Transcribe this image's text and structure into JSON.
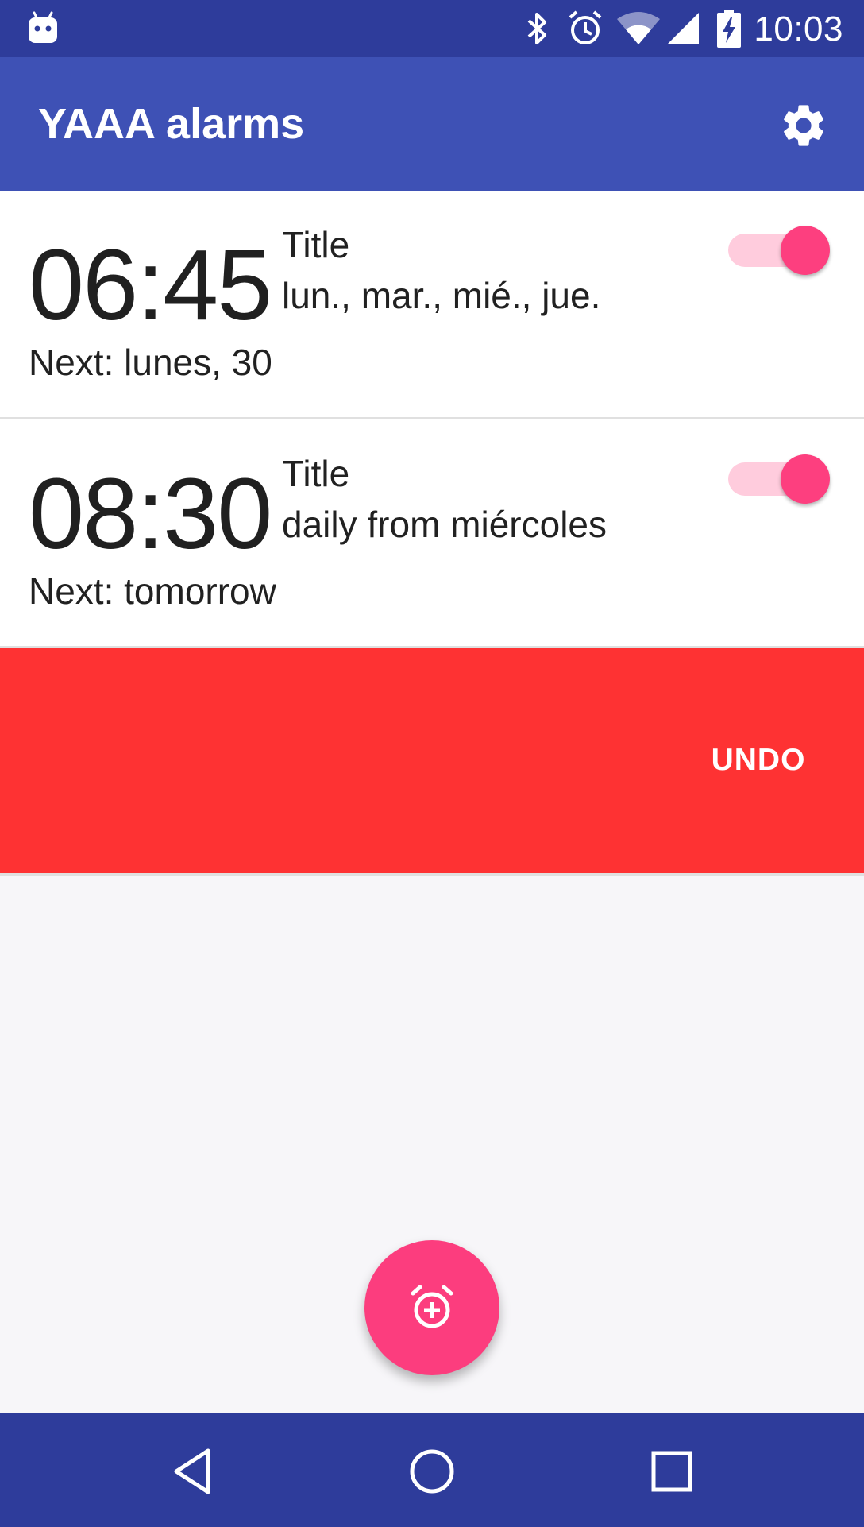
{
  "status_bar": {
    "time": "10:03",
    "icons": [
      "android-notification-icon",
      "bluetooth-icon",
      "alarm-clock-icon",
      "wifi-icon",
      "cell-signal-icon",
      "battery-charging-icon"
    ]
  },
  "app_bar": {
    "title": "YAAA alarms",
    "settings_icon": "gear-icon"
  },
  "alarms": [
    {
      "time": "06:45",
      "title": "Title",
      "days": "lun., mar., mié., jue.",
      "next": "Next: lunes, 30",
      "enabled": true
    },
    {
      "time": "08:30",
      "title": "Title",
      "days": "daily from miércoles",
      "next": "Next: tomorrow",
      "enabled": true
    }
  ],
  "undo_bar": {
    "label": "UNDO"
  },
  "fab": {
    "icon": "add-alarm-icon"
  },
  "nav_bar": {
    "icons": [
      "back-icon",
      "home-icon",
      "recents-icon"
    ]
  },
  "colors": {
    "status_bar": "#2e3c9b",
    "app_bar": "#3e51b5",
    "accent": "#fc3d7e",
    "undo_bar": "#fe3233",
    "background": "#f7f6f9"
  }
}
